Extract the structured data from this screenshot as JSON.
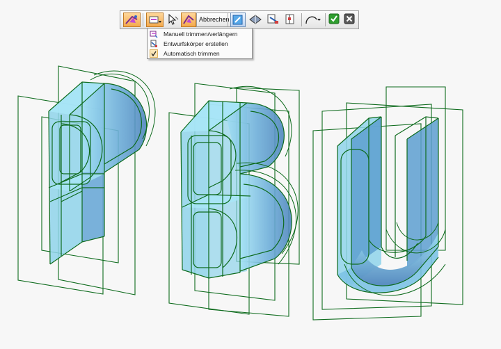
{
  "toolbar": {
    "cancel_label": "Abbrechen",
    "items": [
      "trim-mode-icon",
      "trim-options-icon",
      "select-pointer-icon",
      "auto-trim-icon",
      "cancel-button",
      "extend-icon",
      "flip-icon",
      "create-body-icon",
      "split-icon",
      "curve-dropdown-icon",
      "accept-icon",
      "close-icon"
    ]
  },
  "menu": {
    "items": [
      {
        "label": "Manuell trimmen/verlängern",
        "icon": "manual-trim-icon",
        "checked": false
      },
      {
        "label": "Entwurfskörper erstellen",
        "icon": "create-draft-body-icon",
        "checked": false
      },
      {
        "label": "Automatisch trimmen",
        "icon": "checkmark-icon",
        "checked": true
      }
    ]
  },
  "colors": {
    "solid_face": "#8fd3ea",
    "solid_shade": "#5d9fd0",
    "edge": "#0e6b1d",
    "accent": "#f4a94d",
    "accept": "#2f9e2f"
  },
  "scene": {
    "letters": [
      "P",
      "B",
      "U"
    ]
  }
}
